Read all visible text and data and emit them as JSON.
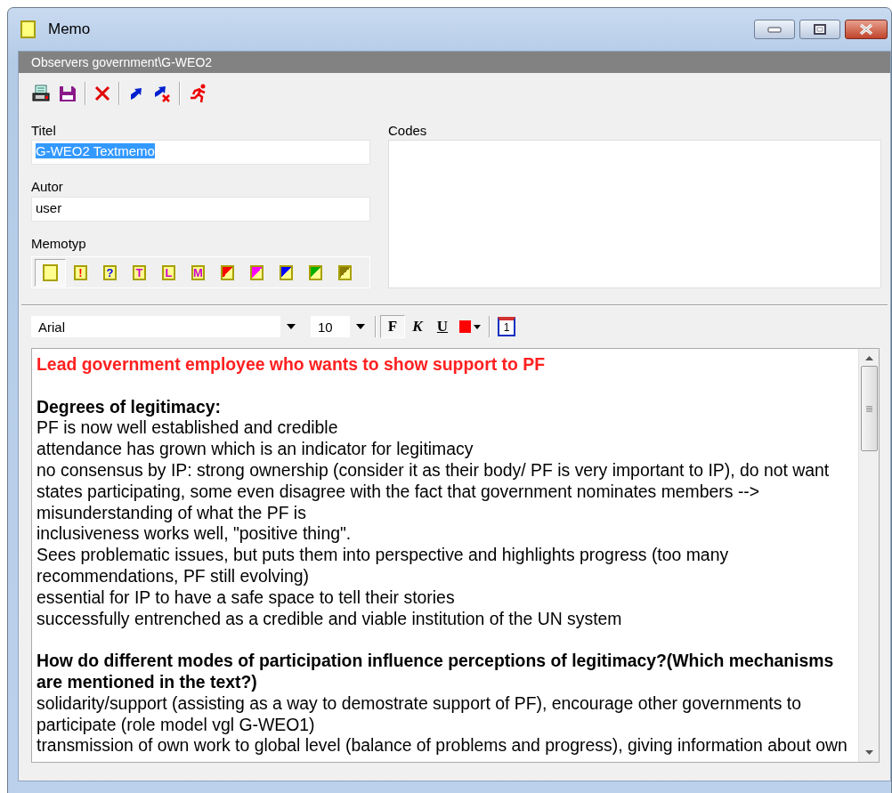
{
  "window": {
    "title": "Memo"
  },
  "path": "Observers government\\G-WEO2",
  "toolbar": [
    {
      "kind": "print"
    },
    {
      "kind": "save"
    },
    {
      "kind": "sep"
    },
    {
      "kind": "delete"
    },
    {
      "kind": "sep"
    },
    {
      "kind": "link"
    },
    {
      "kind": "unlink"
    },
    {
      "kind": "sep"
    },
    {
      "kind": "run"
    }
  ],
  "fields": {
    "title_label": "Titel",
    "title_value": "G-WEO2 Textmemo",
    "author_label": "Autor",
    "author_value": "user",
    "type_label": "Memotyp",
    "codes_label": "Codes"
  },
  "memo_types": [
    {
      "kind": "plain",
      "selected": true
    },
    {
      "kind": "warning",
      "glyph": "!",
      "selected": false
    },
    {
      "kind": "question",
      "glyph": "?",
      "selected": false
    },
    {
      "kind": "letter",
      "glyph": "T",
      "selected": false
    },
    {
      "kind": "letter",
      "glyph": "L",
      "selected": false
    },
    {
      "kind": "letter",
      "glyph": "M",
      "selected": false
    },
    {
      "kind": "corner",
      "color": "#ff0000",
      "selected": false
    },
    {
      "kind": "corner",
      "color": "#ff00ff",
      "selected": false
    },
    {
      "kind": "corner",
      "color": "#0000ff",
      "selected": false
    },
    {
      "kind": "corner",
      "color": "#00b000",
      "selected": false
    },
    {
      "kind": "corner",
      "color": "#8a7a00",
      "selected": false
    }
  ],
  "format": {
    "font": "Arial",
    "size": "10",
    "bold": {
      "label": "F",
      "pressed": true
    },
    "italic": {
      "label": "K",
      "pressed": false
    },
    "underline": {
      "label": "U",
      "pressed": false
    },
    "color_button": {
      "color": "#ff0000"
    },
    "calendar_day": "1"
  },
  "text": [
    {
      "kind": "title",
      "text": "Lead government employee who wants to show support to PF"
    },
    {
      "kind": "heading",
      "text": "Degrees of legitimacy:"
    },
    {
      "kind": "body",
      "text": "PF is now well established and credible"
    },
    {
      "kind": "body",
      "text": "attendance has grown which is an indicator for legitimacy"
    },
    {
      "kind": "body",
      "text": "no consensus by IP: strong ownership (consider it as their body/ PF is very important to IP), do not want states participating, some even disagree with the fact that government nominates members --> misunderstanding of what the PF is"
    },
    {
      "kind": "body",
      "text": "inclusiveness works well, \"positive thing\"."
    },
    {
      "kind": "body",
      "text": "Sees problematic issues, but puts them into perspective and highlights progress (too many recommendations, PF still evolving)"
    },
    {
      "kind": "body",
      "text": "essential for IP to have a safe space to tell their stories"
    },
    {
      "kind": "body",
      "text": "successfully entrenched as a credible and viable institution of the UN system"
    },
    {
      "kind": "heading",
      "text": "How do different modes of participation influence perceptions of legitimacy?(Which mechanisms are mentioned in the text?)"
    },
    {
      "kind": "body",
      "text": "solidarity/support (assisting as a way to demostrate support of PF), encourage other governments to participate (role model vgl G-WEO1)"
    },
    {
      "kind": "body",
      "text": "transmission of own work to global level (balance of problems and progress), giving information about own"
    }
  ]
}
